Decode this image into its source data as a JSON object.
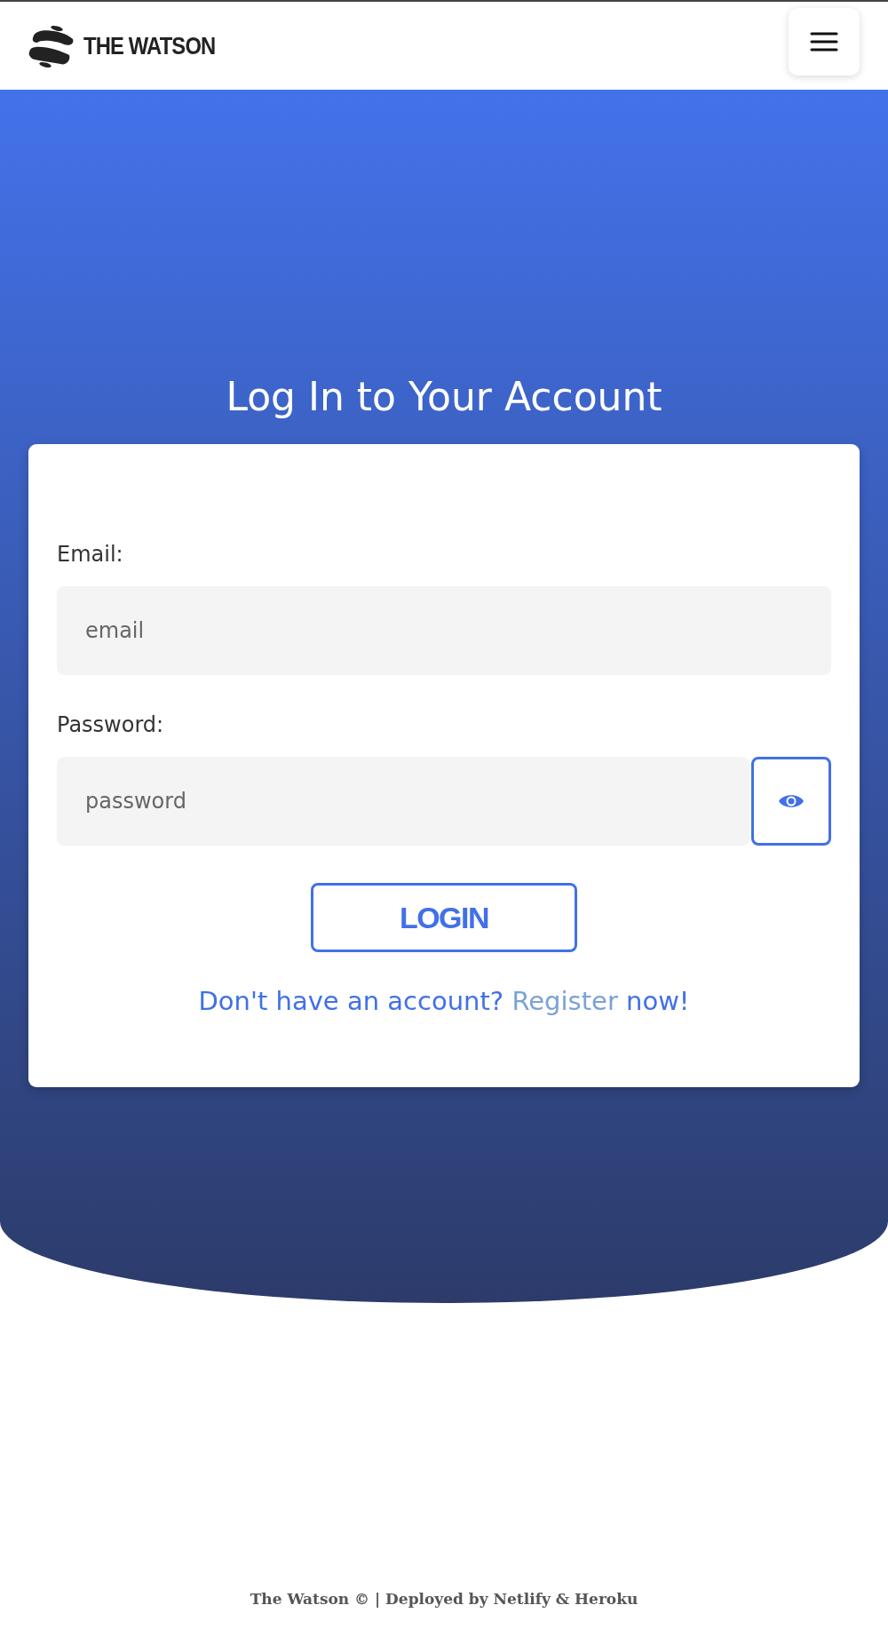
{
  "header": {
    "brand": "THE WATSON"
  },
  "title": "Log In to Your Account",
  "form": {
    "fields": [
      {
        "label": "Email:",
        "placeholder": "email",
        "kind": "email"
      },
      {
        "label": "Password:",
        "placeholder": "password",
        "kind": "password"
      }
    ],
    "submit": "LOGIN",
    "register_prompt": {
      "before": "Don't have an account?",
      "link": "Register",
      "after": "now!"
    }
  },
  "footer": "The Watson © | Deployed by Netlify & Heroku"
}
